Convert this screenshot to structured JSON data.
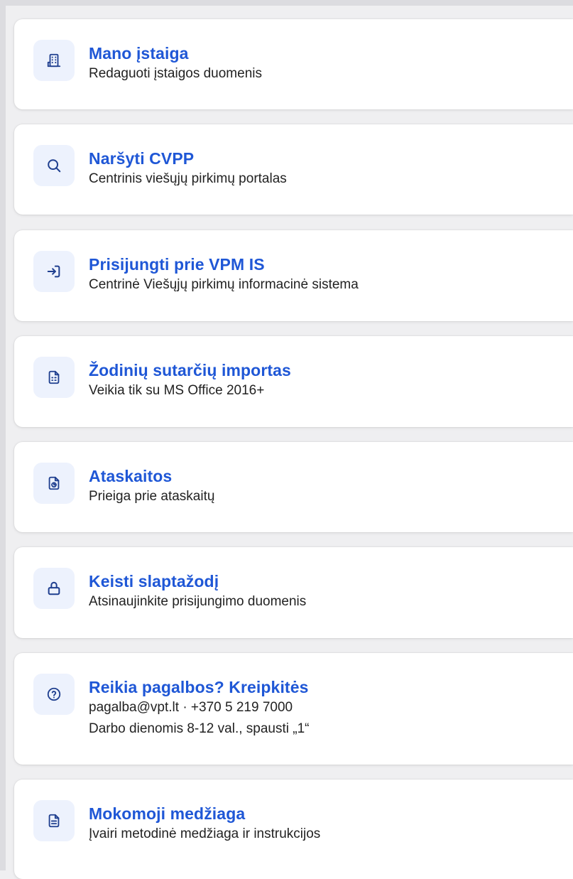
{
  "colors": {
    "title": "#1f57d6",
    "icon_bg": "#edf2fd",
    "card_bg": "#ffffff",
    "page_bg": "#efeff1"
  },
  "items": [
    {
      "icon": "building-icon",
      "title": "Mano įstaiga",
      "lines": [
        "Redaguoti įstaigos duomenis"
      ]
    },
    {
      "icon": "search-icon",
      "title": "Naršyti CVPP",
      "lines": [
        "Centrinis viešųjų pirkimų portalas"
      ]
    },
    {
      "icon": "login-icon",
      "title": "Prisijungti prie VPM IS",
      "lines": [
        "Centrinė Viešųjų pirkimų informacinė sistema"
      ]
    },
    {
      "icon": "spreadsheet-icon",
      "title": "Žodinių sutarčių importas",
      "lines": [
        "Veikia tik su MS Office 2016+"
      ]
    },
    {
      "icon": "report-icon",
      "title": "Ataskaitos",
      "lines": [
        "Prieiga prie ataskaitų"
      ]
    },
    {
      "icon": "lock-icon",
      "title": "Keisti slaptažodį",
      "lines": [
        "Atsinaujinkite prisijungimo duomenis"
      ]
    },
    {
      "icon": "help-icon",
      "title": "Reikia pagalbos? Kreipkitės",
      "lines": [
        "pagalba@vpt.lt · +370 5 219 7000",
        "Darbo dienomis 8-12 val., spausti „1“"
      ]
    },
    {
      "icon": "document-icon",
      "title": "Mokomoji medžiaga",
      "lines": [
        "Įvairi metodinė medžiaga ir instrukcijos"
      ]
    }
  ]
}
